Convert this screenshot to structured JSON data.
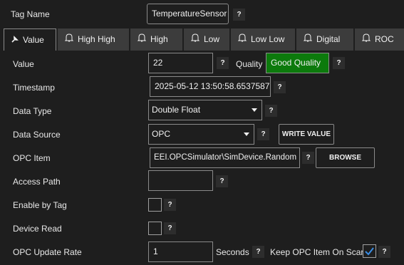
{
  "header": {
    "tag_name_label": "Tag Name",
    "tag_name_value": "TemperatureSensor",
    "help": "?"
  },
  "tabs": [
    {
      "label": "Value",
      "icon": "pin-icon",
      "active": true
    },
    {
      "label": "High High",
      "icon": "bell-icon"
    },
    {
      "label": "High",
      "icon": "bell-icon"
    },
    {
      "label": "Low",
      "icon": "bell-icon"
    },
    {
      "label": "Low Low",
      "icon": "bell-icon"
    },
    {
      "label": "Digital",
      "icon": "bell-icon"
    },
    {
      "label": "ROC",
      "icon": "bell-icon"
    }
  ],
  "form": {
    "value_label": "Value",
    "value": "22",
    "quality_label": "Quality",
    "quality_value": "Good Quality",
    "quality_color": "#0c7a0c",
    "timestamp_label": "Timestamp",
    "timestamp_value": "2025-05-12 13:50:58.6537587",
    "data_type_label": "Data Type",
    "data_type_value": "Double Float",
    "data_source_label": "Data Source",
    "data_source_value": "OPC",
    "write_value_button": "WRITE VALUE",
    "opc_item_label": "OPC Item",
    "opc_item_value": "EEI.OPCSimulator\\SimDevice.Random",
    "browse_button": "BROWSE",
    "access_path_label": "Access Path",
    "access_path_value": "",
    "enable_by_tag_label": "Enable by Tag",
    "enable_by_tag_checked": false,
    "device_read_label": "Device Read",
    "device_read_checked": false,
    "opc_update_rate_label": "OPC Update Rate",
    "opc_update_rate_value": "1",
    "seconds_label": "Seconds",
    "keep_opc_label": "Keep OPC Item On Scan",
    "keep_opc_checked": true,
    "help": "?"
  }
}
